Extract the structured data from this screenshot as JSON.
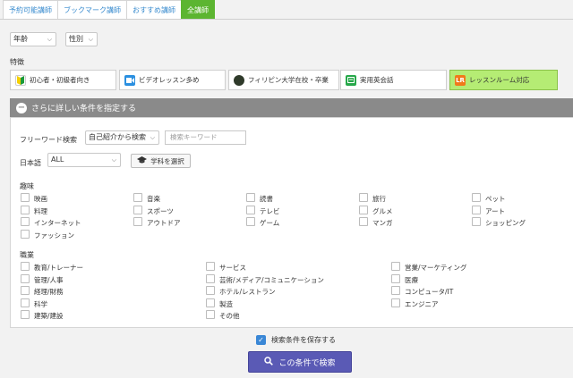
{
  "tabs": [
    "予約可能講師",
    "ブックマーク講師",
    "おすすめ講師",
    "全講師"
  ],
  "filters": {
    "age": "年齢",
    "gender": "性別"
  },
  "features": {
    "heading": "特徴",
    "items": [
      "初心者・初級者向き",
      "ビデオレッスン多め",
      "フィリピン大学在校・卒業",
      "実用英会話",
      "レッスンルーム対応"
    ],
    "icon_texts": [
      "",
      "",
      "",
      "",
      "LR"
    ]
  },
  "advanced": {
    "toggle_label": "さらに詳しい条件を指定する"
  },
  "keyword": {
    "label": "フリーワード検索",
    "scope": "自己紹介から検索",
    "placeholder": "検索キーワード"
  },
  "japanese": {
    "label": "日本語",
    "value": "ALL",
    "subject_button": "学科を選択"
  },
  "hobbies": {
    "heading": "趣味",
    "items": [
      "映画",
      "音楽",
      "読書",
      "旅行",
      "ペット",
      "料理",
      "スポーツ",
      "テレビ",
      "グルメ",
      "アート",
      "インターネット",
      "アウトドア",
      "ゲーム",
      "マンガ",
      "ショッピング",
      "ファッション"
    ]
  },
  "jobs": {
    "heading": "職業",
    "items": [
      "教育/トレーナー",
      "サービス",
      "営業/マーケティング",
      "管理/人事",
      "芸術/メディア/コミュニケーション",
      "医療",
      "経理/財務",
      "ホテル/レストラン",
      "コンピュータ/IT",
      "科学",
      "製造",
      "エンジニア",
      "建築/建設",
      "その他"
    ]
  },
  "save_conditions": {
    "label": "検索条件を保存する",
    "checked": true
  },
  "search_button": "この条件で検索",
  "colors": {
    "active_tab": "#5cb531",
    "selected_feature": "#b5ec74",
    "search_button": "#5a5ab5",
    "link": "#3a8ccf"
  }
}
